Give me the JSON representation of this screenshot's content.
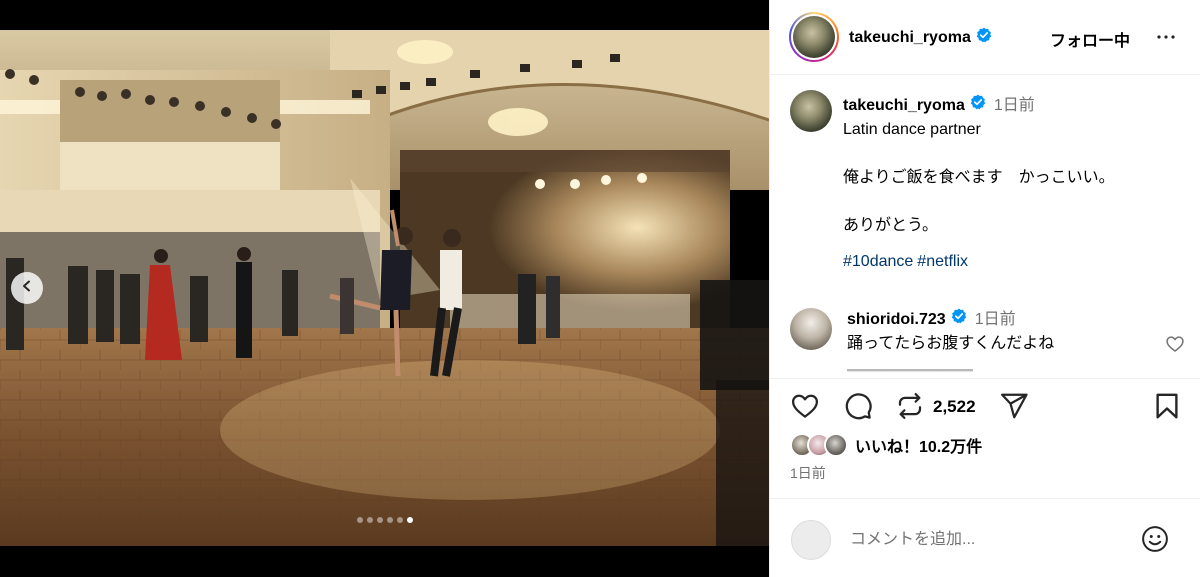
{
  "post": {
    "username": "takeuchi_ryoma",
    "verified": true,
    "follow_label": "フォロー中",
    "more_icon": "more-horizontal-icon",
    "media": {
      "slide_count": 6,
      "active_slide": 6,
      "prev_icon": "chevron-left-icon"
    },
    "caption": {
      "username": "takeuchi_ryoma",
      "time": "1日前",
      "lines": [
        "Latin dance partner",
        "",
        "俺よりご飯を食べます　かっこいい。",
        "",
        "ありがとう。"
      ],
      "tags": [
        "#10dance",
        "#netflix"
      ]
    },
    "comments": [
      {
        "username": "shioridoi.723",
        "time": "1日前",
        "text": "踊ってたらお腹すくんだよね",
        "like_icon": "heart-outline-icon"
      }
    ],
    "actions": {
      "like_icon": "heart-outline-icon",
      "comment_icon": "comment-bubble-icon",
      "repost_icon": "repost-icon",
      "repost_count": "2,522",
      "share_icon": "send-icon",
      "save_icon": "bookmark-icon"
    },
    "likes_text": "いいね！10.2万件",
    "post_time": "1日前",
    "comment_box": {
      "placeholder": "コメントを追加...",
      "emoji_icon": "emoji-icon"
    },
    "colors": {
      "verified": "#0095f6",
      "link": "#00376b",
      "muted": "#737373",
      "divider": "#efefef"
    }
  }
}
